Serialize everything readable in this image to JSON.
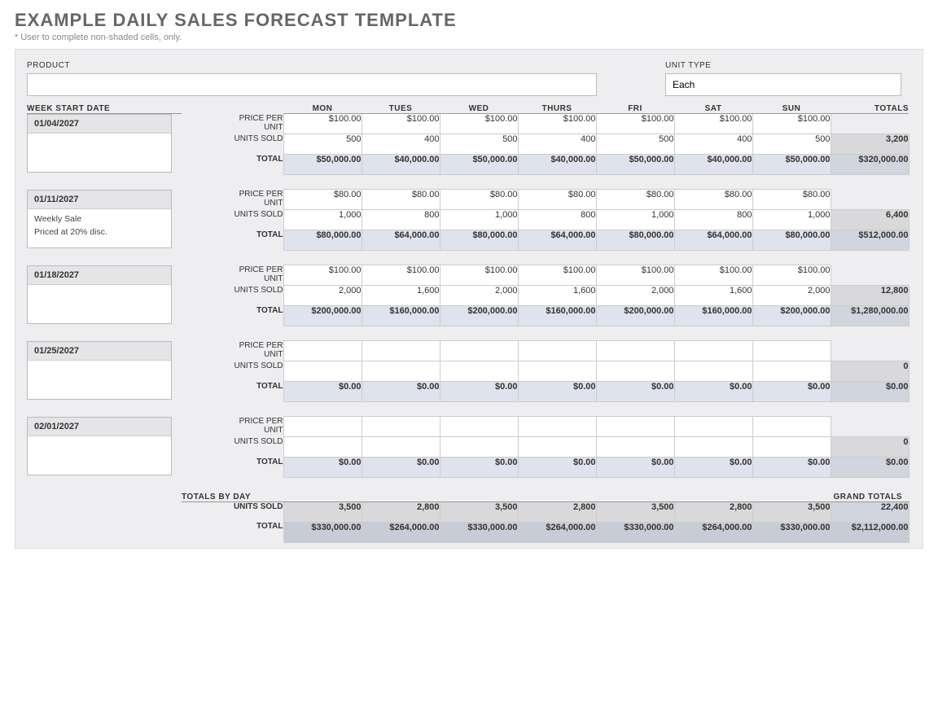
{
  "title": "EXAMPLE DAILY SALES FORECAST TEMPLATE",
  "hint": "* User to complete non-shaded cells, only.",
  "labels": {
    "product": "PRODUCT",
    "unit_type": "UNIT TYPE",
    "week_start": "WEEK START DATE",
    "price_per_unit": "PRICE PER UNIT",
    "units_sold": "UNITS SOLD",
    "total": "TOTAL",
    "totals": "TOTALS",
    "totals_by_day": "TOTALS BY DAY",
    "grand_totals": "GRAND TOTALS"
  },
  "inputs": {
    "product": "",
    "unit_type": "Each"
  },
  "days": [
    "MON",
    "TUES",
    "WED",
    "THURS",
    "FRI",
    "SAT",
    "SUN"
  ],
  "weeks": [
    {
      "date": "01/04/2027",
      "notes": [],
      "price": [
        "$100.00",
        "$100.00",
        "$100.00",
        "$100.00",
        "$100.00",
        "$100.00",
        "$100.00"
      ],
      "units": [
        "500",
        "400",
        "500",
        "400",
        "500",
        "400",
        "500"
      ],
      "units_total": "3,200",
      "totals": [
        "$50,000.00",
        "$40,000.00",
        "$50,000.00",
        "$40,000.00",
        "$50,000.00",
        "$40,000.00",
        "$50,000.00"
      ],
      "row_total": "$320,000.00"
    },
    {
      "date": "01/11/2027",
      "notes": [
        "Weekly Sale",
        "Priced at 20% disc."
      ],
      "price": [
        "$80.00",
        "$80.00",
        "$80.00",
        "$80.00",
        "$80.00",
        "$80.00",
        "$80.00"
      ],
      "units": [
        "1,000",
        "800",
        "1,000",
        "800",
        "1,000",
        "800",
        "1,000"
      ],
      "units_total": "6,400",
      "totals": [
        "$80,000.00",
        "$64,000.00",
        "$80,000.00",
        "$64,000.00",
        "$80,000.00",
        "$64,000.00",
        "$80,000.00"
      ],
      "row_total": "$512,000.00"
    },
    {
      "date": "01/18/2027",
      "notes": [],
      "price": [
        "$100.00",
        "$100.00",
        "$100.00",
        "$100.00",
        "$100.00",
        "$100.00",
        "$100.00"
      ],
      "units": [
        "2,000",
        "1,600",
        "2,000",
        "1,600",
        "2,000",
        "1,600",
        "2,000"
      ],
      "units_total": "12,800",
      "totals": [
        "$200,000.00",
        "$160,000.00",
        "$200,000.00",
        "$160,000.00",
        "$200,000.00",
        "$160,000.00",
        "$200,000.00"
      ],
      "row_total": "$1,280,000.00"
    },
    {
      "date": "01/25/2027",
      "notes": [],
      "price": [
        "",
        "",
        "",
        "",
        "",
        "",
        ""
      ],
      "units": [
        "",
        "",
        "",
        "",
        "",
        "",
        ""
      ],
      "units_total": "0",
      "totals": [
        "$0.00",
        "$0.00",
        "$0.00",
        "$0.00",
        "$0.00",
        "$0.00",
        "$0.00"
      ],
      "row_total": "$0.00"
    },
    {
      "date": "02/01/2027",
      "notes": [],
      "price": [
        "",
        "",
        "",
        "",
        "",
        "",
        ""
      ],
      "units": [
        "",
        "",
        "",
        "",
        "",
        "",
        ""
      ],
      "units_total": "0",
      "totals": [
        "$0.00",
        "$0.00",
        "$0.00",
        "$0.00",
        "$0.00",
        "$0.00",
        "$0.00"
      ],
      "row_total": "$0.00"
    }
  ],
  "day_totals": {
    "units": [
      "3,500",
      "2,800",
      "3,500",
      "2,800",
      "3,500",
      "2,800",
      "3,500"
    ],
    "units_grand": "22,400",
    "money": [
      "$330,000.00",
      "$264,000.00",
      "$330,000.00",
      "$264,000.00",
      "$330,000.00",
      "$264,000.00",
      "$330,000.00"
    ],
    "money_grand": "$2,112,000.00"
  }
}
